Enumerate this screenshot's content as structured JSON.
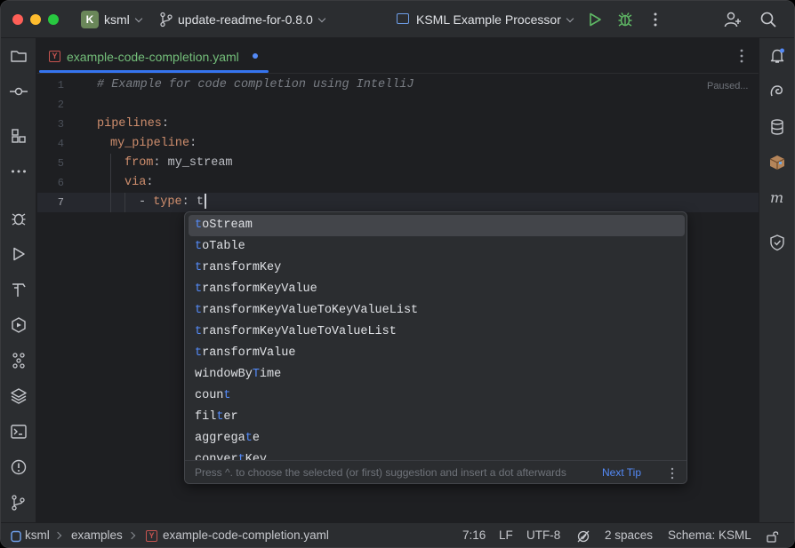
{
  "titlebar": {
    "project_badge": "K",
    "project_name": "ksml",
    "branch": "update-readme-for-0.8.0",
    "run_config": "KSML Example Processor",
    "icons": [
      "git-branch-icon",
      "run-icon",
      "debug-icon",
      "more-icon",
      "add-user-icon",
      "search-icon"
    ]
  },
  "tab": {
    "file_type": "Y",
    "label": "example-code-completion.yaml",
    "modified": true
  },
  "editor": {
    "status": "Paused...",
    "lines": [
      {
        "n": "1",
        "text": "# Example for code completion using IntelliJ"
      },
      {
        "n": "2",
        "text": ""
      },
      {
        "n": "3",
        "key": "pipelines",
        "sep": ":"
      },
      {
        "n": "4",
        "key": "my_pipeline",
        "sep": ":"
      },
      {
        "n": "5",
        "key": "from",
        "sep": ":",
        "value": " my_stream"
      },
      {
        "n": "6",
        "key": "via",
        "sep": ":"
      },
      {
        "n": "7",
        "prefix": "- ",
        "key": "type",
        "sep": ":",
        "value": " t"
      }
    ]
  },
  "completion": {
    "items": [
      {
        "pre": "",
        "match": "t",
        "post": "oStream"
      },
      {
        "pre": "",
        "match": "t",
        "post": "oTable"
      },
      {
        "pre": "",
        "match": "t",
        "post": "ransformKey"
      },
      {
        "pre": "",
        "match": "t",
        "post": "ransformKeyValue"
      },
      {
        "pre": "",
        "match": "t",
        "post": "ransformKeyValueToKeyValueList"
      },
      {
        "pre": "",
        "match": "t",
        "post": "ransformKeyValueToValueList"
      },
      {
        "pre": "",
        "match": "t",
        "post": "ransformValue"
      },
      {
        "pre": "windowBy",
        "match": "T",
        "post": "ime"
      },
      {
        "pre": "coun",
        "match": "t",
        "post": ""
      },
      {
        "pre": "fil",
        "match": "t",
        "post": "er"
      },
      {
        "pre": "aggrega",
        "match": "t",
        "post": "e"
      },
      {
        "pre": "conver",
        "match": "t",
        "post": "Key"
      }
    ],
    "selected_index": 0,
    "tip": "Press ^. to choose the selected (or first) suggestion and insert a dot afterwards",
    "next_tip": "Next Tip"
  },
  "statusbar": {
    "breadcrumbs": [
      "ksml",
      "examples",
      "example-code-completion.yaml"
    ],
    "position": "7:16",
    "line_sep": "LF",
    "encoding": "UTF-8",
    "indent": "2 spaces",
    "schema": "Schema: KSML"
  },
  "colors": {
    "accent": "#3574f0",
    "match": "#548af7",
    "yaml_key": "#cf8e6d",
    "tab_text": "#73bd79"
  }
}
